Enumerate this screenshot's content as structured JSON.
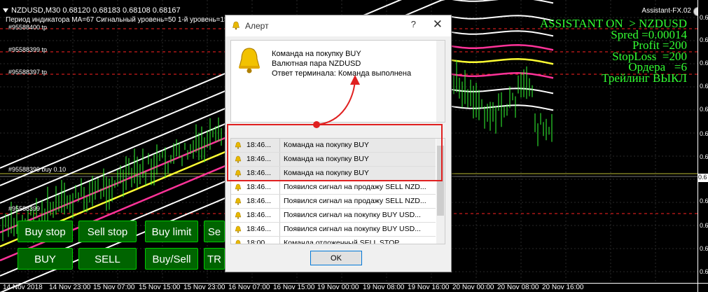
{
  "chart": {
    "symbol_line": "NZDUSD,M30  0.68120 0.68183 0.68108 0.68167",
    "indicator_line": "Период индикатора MA=67  Сигнальный уровень=50  1-й уровень=15",
    "ea_name": "Assistant-FX.02",
    "info": [
      "ASSISTANT ON  > NZDUSD",
      "Spred =0.00014",
      "Profit =200",
      "StopLoss  =200",
      "Ордера   =6",
      "Трейлинг ВЫКЛ"
    ],
    "order_labels": [
      "#95588400 tp",
      "#95588399 tp",
      "#95588397 tp",
      "#95588399 buy 0.10",
      "#95588399"
    ],
    "price_labels": [
      "0.6",
      "0.6",
      "0.6",
      "0.6",
      "0.6",
      "0.6",
      "0.6",
      "0.6",
      "0.6",
      "0.6",
      "0.6",
      "0.6"
    ],
    "current_price": "0.6",
    "time_labels": [
      "14 Nov 2018",
      "14 Nov 23:00",
      "15 Nov 07:00",
      "15 Nov 15:00",
      "15 Nov 23:00",
      "16 Nov 07:00",
      "16 Nov 15:00",
      "19 Nov 00:00",
      "19 Nov 08:00",
      "19 Nov 16:00",
      "20 Nov 00:00",
      "20 Nov 08:00",
      "20 Nov 16:00"
    ],
    "colors": {
      "background": "#000000",
      "candles": "#33ff33",
      "info_text": "#33ff33",
      "ma_white": "#ffffff",
      "ma_magenta": "#ff3399",
      "ma_yellow": "#ffff33",
      "level_red": "#ff2222"
    }
  },
  "buttons": {
    "buy_stop": "Buy stop",
    "sell_stop": "Sell stop",
    "buy_limit": "Buy limit",
    "sell_limit": "Se",
    "buy": "BUY",
    "sell": "SELL",
    "buy_sell": "Buy/Sell",
    "tr": "TR"
  },
  "dialog": {
    "title": "Алерт",
    "help": "?",
    "close": "✕",
    "message": [
      "Команда на покупку BUY",
      "Валютная пара NZDUSD",
      "Ответ терминала:  Команда выполнена"
    ],
    "rows": [
      {
        "time": "18:46...",
        "text": "Команда на покупку BUY"
      },
      {
        "time": "18:46...",
        "text": "Команда на покупку BUY"
      },
      {
        "time": "18:46...",
        "text": "Команда на покупку BUY"
      },
      {
        "time": "18:46...",
        "text": "Появился сигнал на продажу SELL NZD..."
      },
      {
        "time": "18:46...",
        "text": "Появился сигнал на продажу SELL NZD..."
      },
      {
        "time": "18:46...",
        "text": "Появился сигнал на покупку BUY USD..."
      },
      {
        "time": "18:46...",
        "text": "Появился сигнал на покупку BUY USD..."
      },
      {
        "time": "18:00",
        "text": "Команда отложенный SELL STOP"
      }
    ],
    "ok": "OK"
  }
}
